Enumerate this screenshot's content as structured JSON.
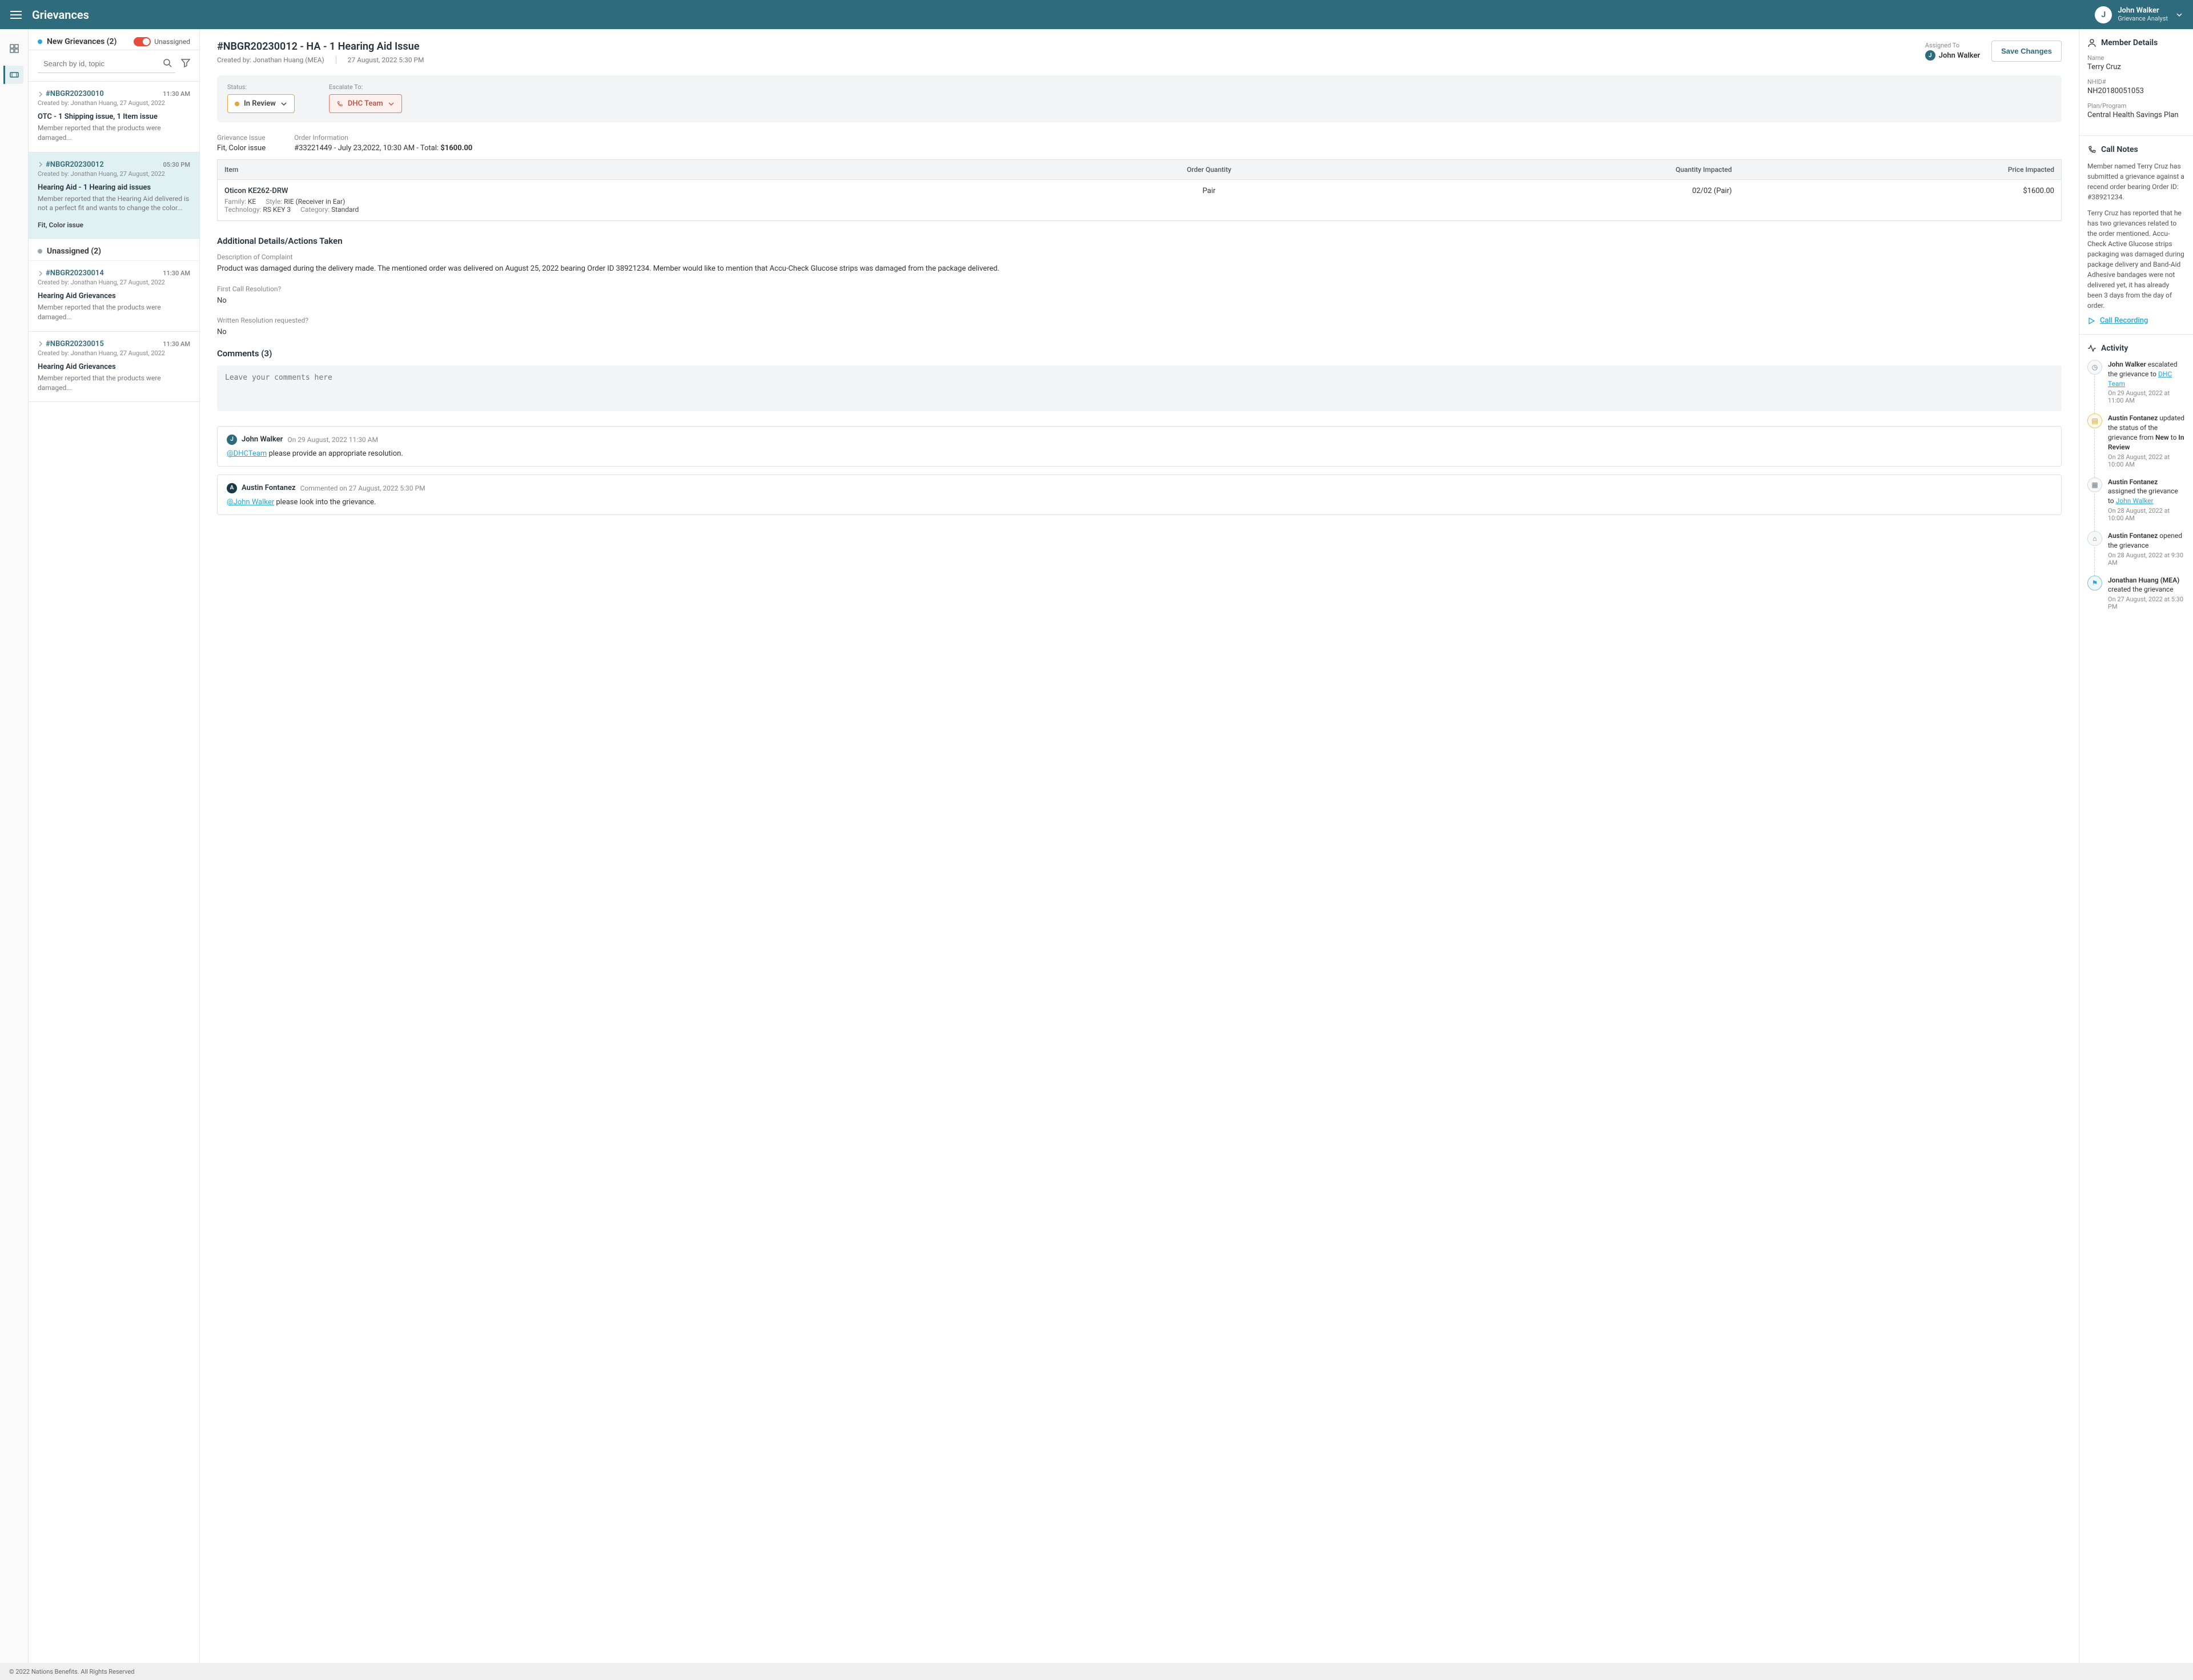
{
  "app": {
    "title": "Grievances"
  },
  "user": {
    "initial": "J",
    "name": "John Walker",
    "role": "Grievance Analyst"
  },
  "list": {
    "new_title": "New Grievances (2)",
    "unassigned_toggle": "Unassigned",
    "search_placeholder": "Search by id, topic",
    "unassigned_title": "Unassigned (2)",
    "items": [
      {
        "id": "#NBGR20230010",
        "time": "11:30 AM",
        "created": "Created by: Jonathan Huang, 27 August, 2022",
        "title": "OTC - 1 Shipping issue, 1 Item issue",
        "snippet": "Member reported that the products were damaged..."
      },
      {
        "id": "#NBGR20230012",
        "time": "05:30 PM",
        "created": "Created by: Jonathan Huang, 27 August, 2022",
        "title": "Hearing Aid - 1 Hearing aid issues",
        "snippet": "Member reported that the Hearing Aid delivered is not a perfect fit and wants to change the color...",
        "tag": "Fit, Color issue"
      },
      {
        "id": "#NBGR20230014",
        "time": "11:30 AM",
        "created": "Created by: Jonathan Huang, 27 August, 2022",
        "title": "Hearing Aid Grievances",
        "snippet": "Member reported that the products were damaged..."
      },
      {
        "id": "#NBGR20230015",
        "time": "11:30 AM",
        "created": "Created by: Jonathan Huang, 27 August, 2022",
        "title": "Hearing Aid Grievances",
        "snippet": "Member reported that the products were damaged..."
      }
    ]
  },
  "detail": {
    "title": "#NBGR20230012 - HA - 1 Hearing Aid Issue",
    "created_by_lbl": "Created by:",
    "created_by_val": "Jonathan Huang (MEA)",
    "created_date": "27 August, 2022  5:30 PM",
    "assigned_lbl": "Assigned To",
    "assigned_user": "John Walker",
    "assigned_initial": "J",
    "save_label": "Save Changes",
    "status_lbl": "Status:",
    "status_val": "In Review",
    "escalate_lbl": "Escalate To:",
    "escalate_val": "DHC Team",
    "grievance_issue_lbl": "Grievance Issue",
    "grievance_issue_val": "Fit, Color issue",
    "order_info_lbl": "Order Information",
    "order_info_val_prefix": "#33221449 - July 23,2022, 10:30 AM - Total: ",
    "order_total": "$1600.00",
    "table": {
      "h_item": "Item",
      "h_qty": "Order Quantity",
      "h_impacted": "Quantity Impacted",
      "h_price": "Price Impacted",
      "r_name": "Oticon KE262-DRW",
      "r_family_lbl": "Family:",
      "r_family_val": "KE",
      "r_style_lbl": "Style:",
      "r_style_val": "RIE (Receiver in Ear)",
      "r_tech_lbl": "Technology:",
      "r_tech_val": "RS KEY 3",
      "r_cat_lbl": "Category:",
      "r_cat_val": "Standard",
      "r_qty": "Pair",
      "r_impacted": "02/02 (Pair)",
      "r_price": "$1600.00"
    },
    "details_h": "Additional Details/Actions Taken",
    "complaint_lbl": "Description of Complaint",
    "complaint_val": "Product was damaged during the delivery made. The mentioned order was delivered on August 25, 2022 bearing Order ID 38921234. Member would like to mention that Accu-Check Glucose strips was damaged from the package delivered.",
    "fcr_lbl": "First Call Resolution?",
    "fcr_val": "No",
    "written_lbl": "Written Resolution requested?",
    "written_val": "No",
    "comments_h": "Comments (3)",
    "comment_placeholder": "Leave your comments here",
    "comments": [
      {
        "initial": "J",
        "author": "John Walker",
        "date": "On 29 August, 2022  11:30 AM",
        "mention": "@DHCTeam",
        "body": " please provide an appropriate resolution."
      },
      {
        "initial": "A",
        "author": "Austin Fontanez",
        "date": "Commented on 27 August, 2022  5:30 PM",
        "mention": "@John Walker",
        "body": " please look into the grievance."
      }
    ]
  },
  "member": {
    "title": "Member Details",
    "name_lbl": "Name",
    "name_val": "Terry Cruz",
    "nhid_lbl": "NHID#",
    "nhid_val": "NH20180051053",
    "plan_lbl": "Plan/Program",
    "plan_val": "Central Health Savings Plan"
  },
  "callnotes": {
    "title": "Call Notes",
    "p1": "Member named Terry Cruz has submitted a grievance against a recend order bearing Order ID: #38921234.",
    "p2": "Terry Cruz has reported that he has two grievances related to the order mentioned. Accu-Check Active Glucose strips packaging was damaged during package delivery and Band-Aid Adhesive bandages were not delivered yet, it has already been 3 days from the day of order.",
    "link": "Call Recording"
  },
  "activity": {
    "title": "Activity",
    "items": [
      {
        "pre": "John Walker",
        "mid": " escalated the grievance to ",
        "link": "DHC Team",
        "post": "",
        "date": "On 29 August, 2022 at 11:00 AM"
      },
      {
        "pre": "Austin Fontanez",
        "mid": " updated the status of the grievance from ",
        "bold1": "New",
        "mid2": " to ",
        "bold2": "In Review",
        "date": "On 28 August, 2022 at 10:00 AM"
      },
      {
        "pre": "Austin Fontanez",
        "mid": " assigned the grievance to ",
        "link": "John Walker",
        "date": "On 28 August, 2022 at 10:00 AM"
      },
      {
        "pre": "Austin Fontanez",
        "mid": " opened the grievance",
        "date": "On 28 August, 2022 at 9:30 AM"
      },
      {
        "pre": "Jonathan Huang (MEA)",
        "mid": " created the grievance",
        "date": "On 27 August, 2022 at 5:30 PM"
      }
    ]
  },
  "footer": "© 2022 Nations Benefits. All Rights Reserved"
}
